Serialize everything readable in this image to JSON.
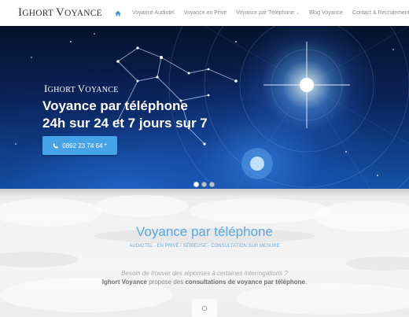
{
  "header": {
    "logo_first": "I",
    "logo_rest_a": "GHORT ",
    "logo_second": "V",
    "logo_rest_b": "OYANCE",
    "home_icon": "home-icon",
    "nav": [
      {
        "label": "Voyance Audiotel"
      },
      {
        "label": "Voyance en Privé"
      },
      {
        "label": "Voyance par Téléphone"
      },
      {
        "label": "Blog Voyance"
      },
      {
        "label": "Contact & Recrutement"
      }
    ],
    "chevron": "⌄",
    "accent_color": "#3d98db"
  },
  "hero": {
    "brand_first": "I",
    "brand_rest_a": "GHORT ",
    "brand_second": "V",
    "brand_rest_b": "OYANCE",
    "line1": "Voyance par téléphone",
    "line2": "24h sur 24 et 7 jours sur 7",
    "phone_icon": "phone-icon",
    "phone_label": "0892 23 74 64 *",
    "button_color": "#47a3e8",
    "slides_total": 3,
    "slide_active": 1
  },
  "section": {
    "title": "Voyance par téléphone",
    "subtitle": "AUDIOTEL - EN PRIVÉ / SÉRIEUSE - CONSULTATION SUR MESURE",
    "intro_line1": "Besoin de trouver des réponses à certaines interrogations ?",
    "intro_brand": "Ighort Voyance",
    "intro_mid": " propose des ",
    "intro_bold": "consultations de voyance par téléphone",
    "intro_end": ".",
    "title_color": "#5aa8de"
  }
}
